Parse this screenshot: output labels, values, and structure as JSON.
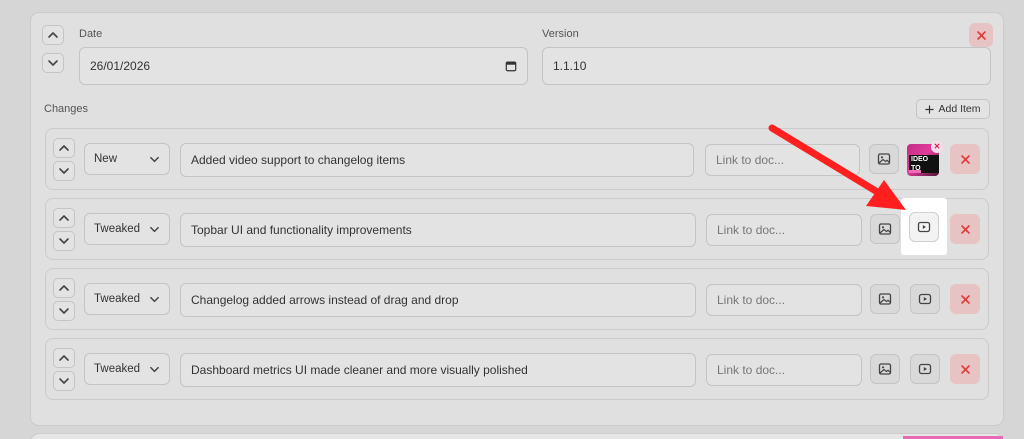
{
  "header": {
    "date_label": "Date",
    "date_value": "26/01/2026",
    "version_label": "Version",
    "version_value": "1.1.10"
  },
  "changes": {
    "label": "Changes",
    "add_item_label": "Add Item",
    "link_placeholder": "Link to doc...",
    "items": [
      {
        "type": "New",
        "description": "Added video support to changelog items",
        "has_video_thumbnail": true,
        "thumbnail_text": "IDEO TO"
      },
      {
        "type": "Tweaked",
        "description": "Topbar UI and functionality improvements",
        "has_video_thumbnail": false
      },
      {
        "type": "Tweaked",
        "description": "Changelog added arrows instead of drag and drop",
        "has_video_thumbnail": false
      },
      {
        "type": "Tweaked",
        "description": "Dashboard metrics UI made cleaner and more visually polished",
        "has_video_thumbnail": false
      }
    ]
  },
  "colors": {
    "annotation_arrow": "#ff1f1f",
    "delete_red": "#e23a3a",
    "thumbnail_pink": "#e23c9b"
  },
  "icons": {
    "move_up": "chevron-up-icon",
    "move_down": "chevron-down-icon",
    "select_open": "chevron-down-icon",
    "image": "image-icon",
    "video": "video-icon",
    "delete": "close-icon",
    "add": "plus-icon",
    "date": "calendar-icon"
  }
}
